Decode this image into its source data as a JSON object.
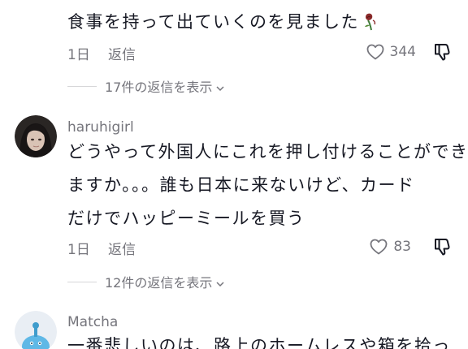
{
  "comments": [
    {
      "lines": [
        "食事を持って出ていくのを見ました"
      ],
      "date": "1日",
      "reply_label": "返信",
      "likes": "344",
      "emoji_icon": "wilted-rose-icon",
      "view_replies_label": "17件の返信を表示"
    },
    {
      "username": "haruhigirl",
      "lines": [
        "どうやって外国人にこれを押し付けることができ",
        "ますか。。。誰も日本に来ないけど、カード",
        "だけでハッピーミールを買う"
      ],
      "date": "1日",
      "reply_label": "返信",
      "likes": "83",
      "view_replies_label": "12件の返信を表示"
    },
    {
      "username": "Matcha",
      "lines": [
        "一番悲しいのは、路上のホームレスや箱を拾っ"
      ]
    }
  ],
  "colors": {
    "text": "#161823",
    "secondary": "#75757c",
    "divider": "#d6d6d8"
  }
}
